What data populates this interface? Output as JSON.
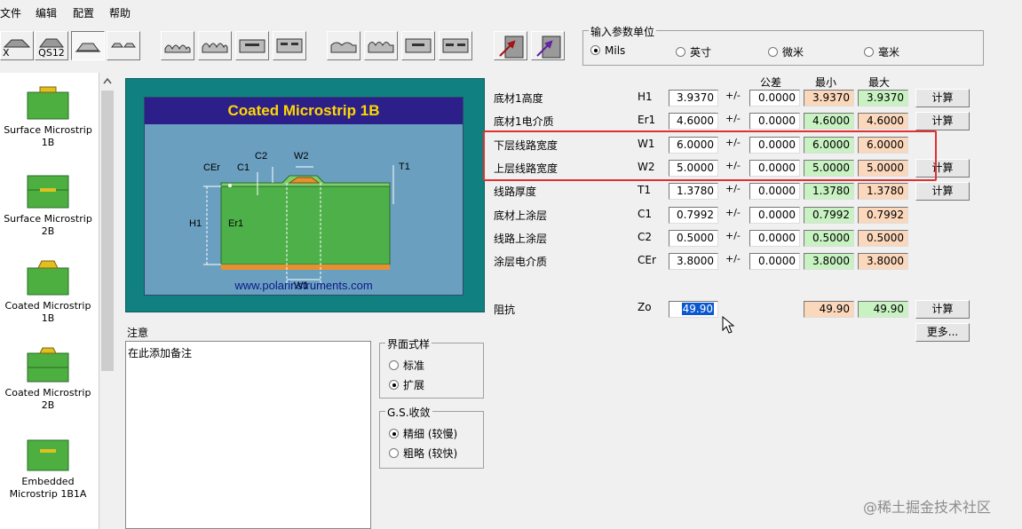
{
  "menu": [
    "文件",
    "编辑",
    "配置",
    "帮助"
  ],
  "toolbar": {
    "btn2_label": "QS12",
    "units_title": "输入参数单位",
    "units": [
      {
        "label": "Mils",
        "checked": true
      },
      {
        "label": "英寸",
        "checked": false
      },
      {
        "label": "微米",
        "checked": false
      },
      {
        "label": "毫米",
        "checked": false
      }
    ]
  },
  "sidebar": {
    "items": [
      {
        "label": "Surface Microstrip 1B"
      },
      {
        "label": "Surface Microstrip 2B"
      },
      {
        "label": "Coated Microstrip 1B"
      },
      {
        "label": "Coated Microstrip 2B"
      },
      {
        "label": "Embedded Microstrip 1B1A"
      }
    ]
  },
  "diagram": {
    "title": "Coated Microstrip 1B",
    "labels": {
      "cer": "CEr",
      "c1": "C1",
      "c2": "C2",
      "w2": "W2",
      "t1": "T1",
      "h1": "H1",
      "er1": "Er1",
      "w1": "W1"
    },
    "url": "www.polarinstruments.com"
  },
  "headers": {
    "tolerance": "公差",
    "min": "最小",
    "max": "最大"
  },
  "params": [
    {
      "name": "底材1高度",
      "sym": "H1",
      "value": "3.9370",
      "pm": "+/-",
      "tol": "0.0000",
      "min": "3.9370",
      "max": "3.9370",
      "min_color": "peach",
      "max_color": "green",
      "calc": "计算"
    },
    {
      "name": "底材1电介质",
      "sym": "Er1",
      "value": "4.6000",
      "pm": "+/-",
      "tol": "0.0000",
      "min": "4.6000",
      "max": "4.6000",
      "min_color": "green",
      "max_color": "peach",
      "calc": "计算"
    },
    {
      "name": "下层线路宽度",
      "sym": "W1",
      "value": "6.0000",
      "pm": "+/-",
      "tol": "0.0000",
      "min": "6.0000",
      "max": "6.0000",
      "min_color": "green",
      "max_color": "peach",
      "calc": ""
    },
    {
      "name": "上层线路宽度",
      "sym": "W2",
      "value": "5.0000",
      "pm": "+/-",
      "tol": "0.0000",
      "min": "5.0000",
      "max": "5.0000",
      "min_color": "green",
      "max_color": "peach",
      "calc": "计算"
    },
    {
      "name": "线路厚度",
      "sym": "T1",
      "value": "1.3780",
      "pm": "+/-",
      "tol": "0.0000",
      "min": "1.3780",
      "max": "1.3780",
      "min_color": "green",
      "max_color": "peach",
      "calc": "计算"
    },
    {
      "name": "底材上涂层",
      "sym": "C1",
      "value": "0.7992",
      "pm": "+/-",
      "tol": "0.0000",
      "min": "0.7992",
      "max": "0.7992",
      "min_color": "green",
      "max_color": "peach",
      "calc": ""
    },
    {
      "name": "线路上涂层",
      "sym": "C2",
      "value": "0.5000",
      "pm": "+/-",
      "tol": "0.0000",
      "min": "0.5000",
      "max": "0.5000",
      "min_color": "green",
      "max_color": "peach",
      "calc": ""
    },
    {
      "name": "涂层电介质",
      "sym": "CEr",
      "value": "3.8000",
      "pm": "+/-",
      "tol": "0.0000",
      "min": "3.8000",
      "max": "3.8000",
      "min_color": "green",
      "max_color": "peach",
      "calc": ""
    }
  ],
  "impedance": {
    "name": "阻抗",
    "sym": "Zo",
    "value": "49.90",
    "min": "49.90",
    "max": "49.90",
    "calc": "计算",
    "more": "更多..."
  },
  "notes": {
    "label": "注意",
    "text": "在此添加备注"
  },
  "ui_style": {
    "title": "界面式样",
    "options": [
      {
        "label": "标准",
        "checked": false
      },
      {
        "label": "扩展",
        "checked": true
      }
    ]
  },
  "gs": {
    "title": "G.S.收敛",
    "options": [
      {
        "label": "精细 (较慢)",
        "checked": true
      },
      {
        "label": "粗略 (较快)",
        "checked": false
      }
    ]
  },
  "watermark": "@稀土掘金技术社区",
  "colors": {
    "green": "#c8f2c2",
    "peach": "#fbd7bc",
    "highlight": "#e03030",
    "diagram_bg": "#118080"
  }
}
